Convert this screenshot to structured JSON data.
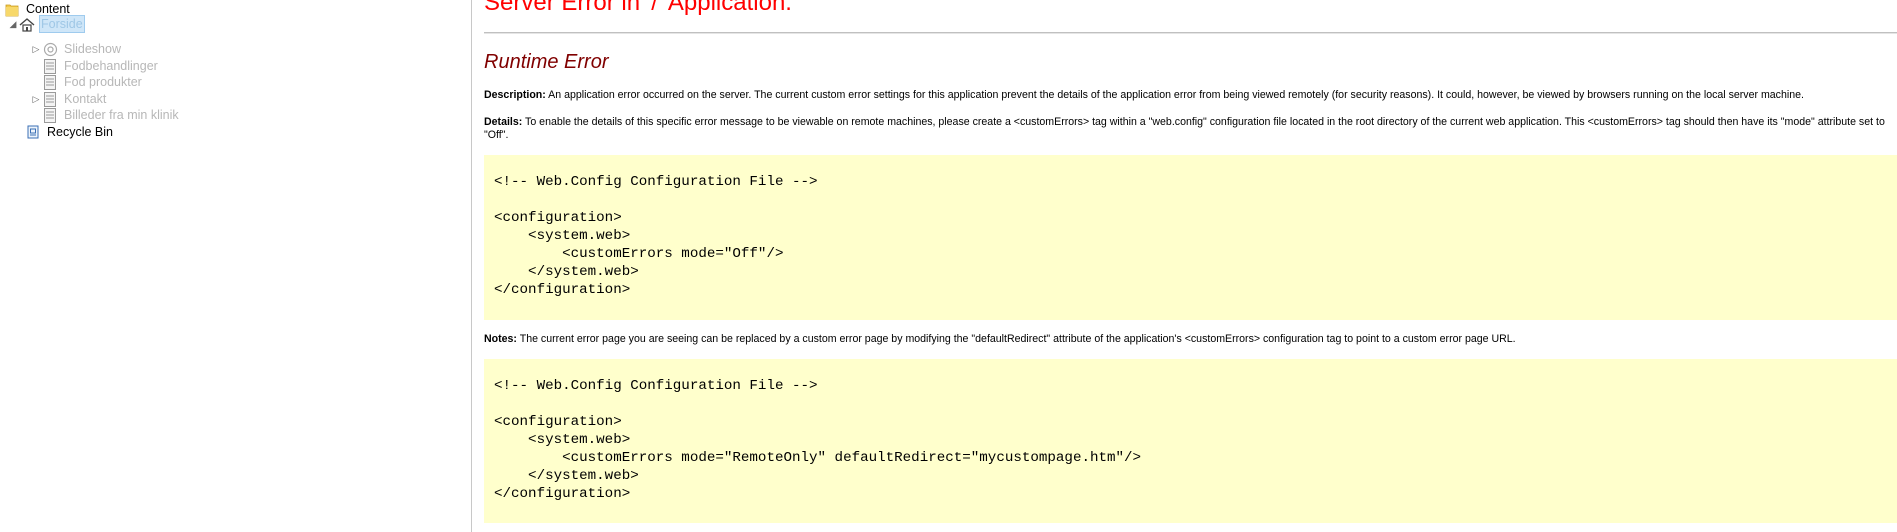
{
  "tree": {
    "root": "Content",
    "home": "Forside",
    "children": [
      "Slideshow",
      "Fodbehandlinger",
      "Fod produkter",
      "Kontakt",
      "Billeder fra min klinik"
    ],
    "recycle": "Recycle Bin"
  },
  "error": {
    "title": "Server Error in '/' Application.",
    "subtitle": "Runtime Error",
    "description_label": "Description:",
    "description": "An application error occurred on the server. The current custom error settings for this application prevent the details of the application error from being viewed remotely (for security reasons). It could, however, be viewed by browsers running on the local server machine.",
    "details_label": "Details:",
    "details": "To enable the details of this specific error message to be viewable on remote machines, please create a <customErrors> tag within a \"web.config\" configuration file located in the root directory of the current web application. This <customErrors> tag should then have its \"mode\" attribute set to \"Off\".",
    "code1": "\n<!-- Web.Config Configuration File -->\n\n<configuration>\n    <system.web>\n        <customErrors mode=\"Off\"/>\n    </system.web>\n</configuration>",
    "notes_label": "Notes:",
    "notes": "The current error page you are seeing can be replaced by a custom error page by modifying the \"defaultRedirect\" attribute of the application's <customErrors> configuration tag to point to a custom error page URL.",
    "code2": "\n<!-- Web.Config Configuration File -->\n\n<configuration>\n    <system.web>\n        <customErrors mode=\"RemoteOnly\" defaultRedirect=\"mycustompage.htm\"/>\n    </system.web>\n</configuration>"
  }
}
